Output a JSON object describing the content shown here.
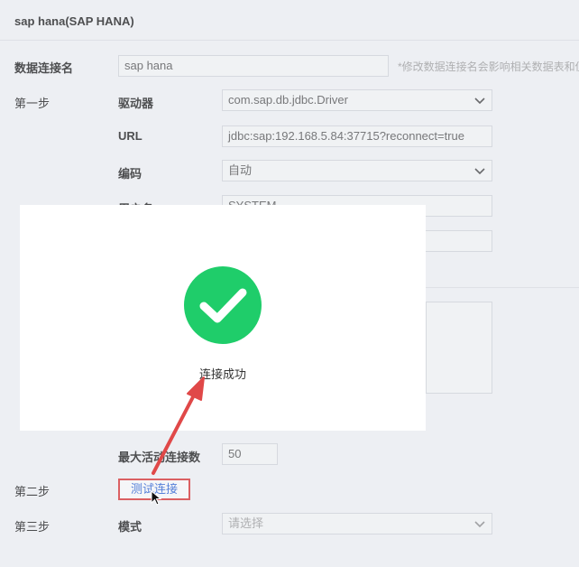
{
  "header": {
    "title": "sap hana(SAP HANA)"
  },
  "connection_name": {
    "label": "数据连接名",
    "value": "sap hana",
    "hint": "*修改数据连接名会影响相关数据表和仪"
  },
  "step1": {
    "label": "第一步",
    "driver": {
      "label": "驱动器",
      "value": "com.sap.db.jdbc.Driver",
      "icon": "chevron-down-icon"
    },
    "url": {
      "label": "URL",
      "value": "jdbc:sap:192.168.5.84:37715?reconnect=true"
    },
    "encoding": {
      "label": "编码",
      "value": "自动",
      "icon": "chevron-down-icon"
    },
    "username": {
      "label": "用户名",
      "value": "SYSTEM"
    },
    "max_active": {
      "label": "最大活动连接数",
      "value": "50"
    }
  },
  "step2": {
    "label": "第二步",
    "test_button": "测试连接"
  },
  "step3": {
    "label": "第三步",
    "mode": {
      "label": "模式",
      "placeholder": "请选择",
      "icon": "chevron-down-icon"
    }
  },
  "modal": {
    "message": "连接成功",
    "icon": "check-circle-icon"
  },
  "colors": {
    "success": "#1fcd6a",
    "highlight": "#e04848",
    "link": "#3c6fd9"
  }
}
